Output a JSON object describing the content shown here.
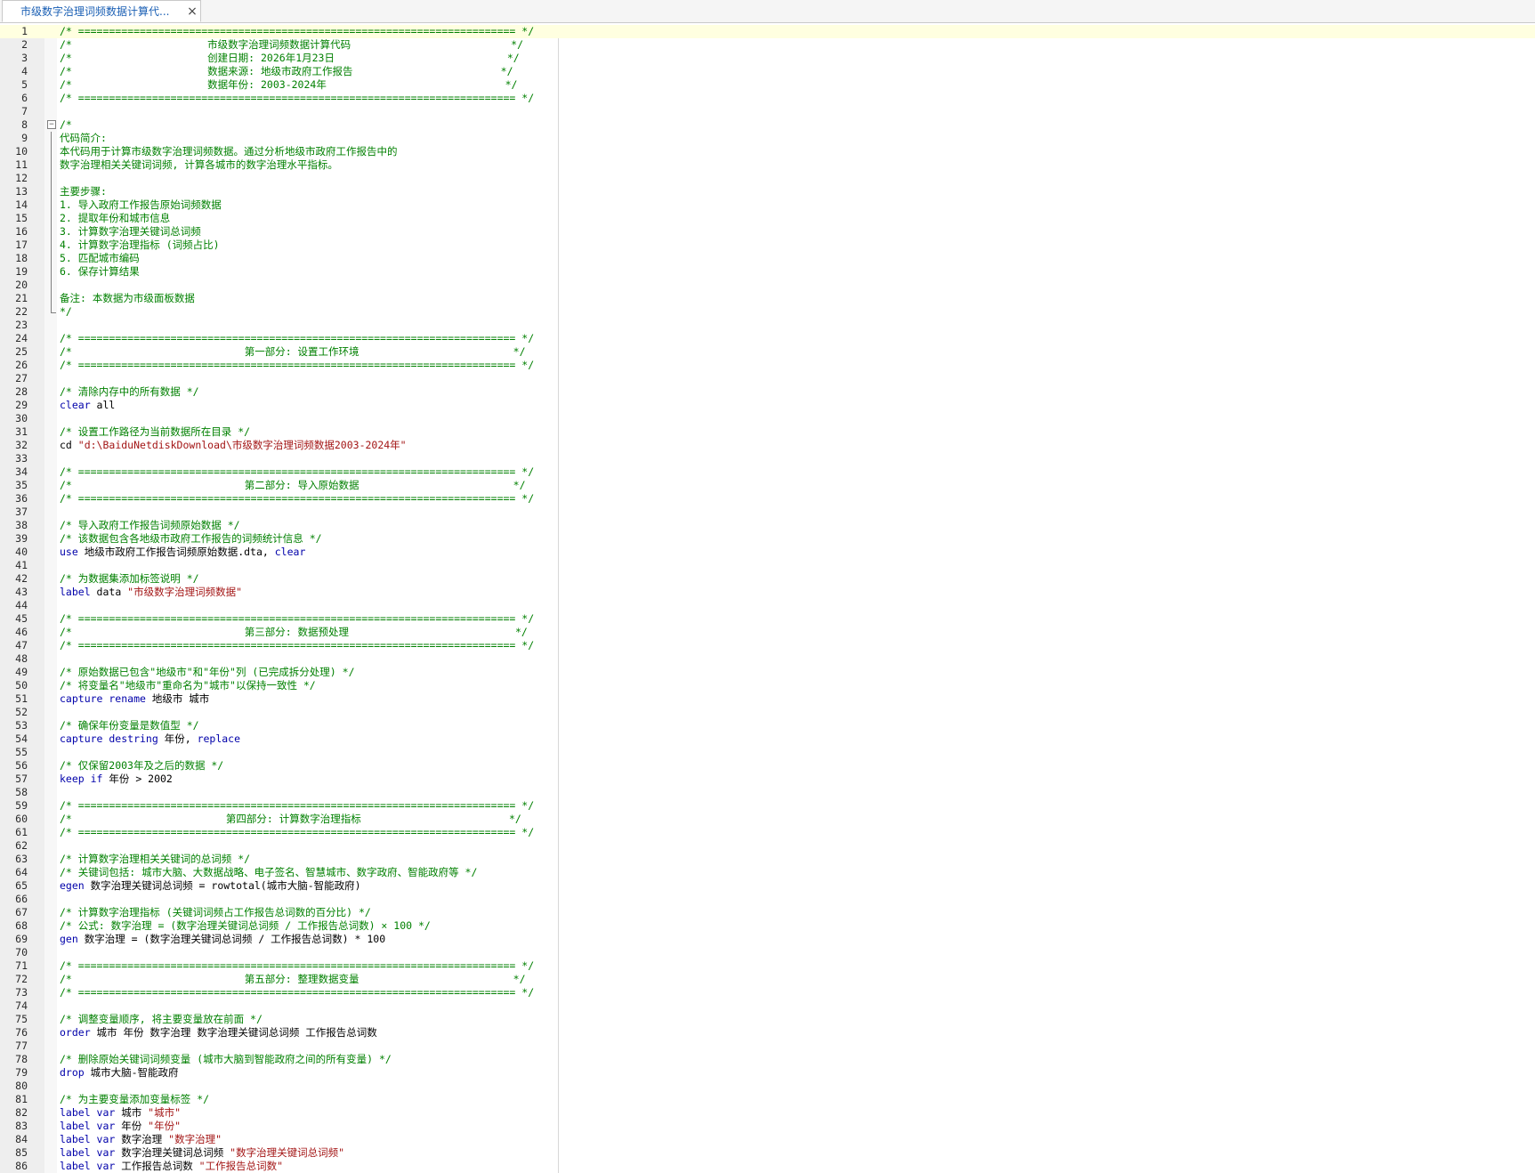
{
  "tab": {
    "title": "市级数字治理词频数据计算代...",
    "close": "×"
  },
  "lines": [
    {
      "n": "1",
      "parts": [
        {
          "t": "/* ======================================================================= */",
          "c": "comment"
        }
      ]
    },
    {
      "n": "2",
      "parts": [
        {
          "t": "/*                      市级数字治理词频数据计算代码                          */",
          "c": "comment"
        }
      ]
    },
    {
      "n": "3",
      "parts": [
        {
          "t": "/*                      创建日期: 2026年1月23日                            */",
          "c": "comment"
        }
      ]
    },
    {
      "n": "4",
      "parts": [
        {
          "t": "/*                      数据来源: 地级市政府工作报告                        */",
          "c": "comment"
        }
      ]
    },
    {
      "n": "5",
      "parts": [
        {
          "t": "/*                      数据年份: 2003-2024年                             */",
          "c": "comment"
        }
      ]
    },
    {
      "n": "6",
      "parts": [
        {
          "t": "/* ======================================================================= */",
          "c": "comment"
        }
      ]
    },
    {
      "n": "7",
      "parts": []
    },
    {
      "n": "8",
      "parts": [
        {
          "t": "/*",
          "c": "comment"
        }
      ]
    },
    {
      "n": "9",
      "parts": [
        {
          "t": "代码简介:",
          "c": "comment"
        }
      ]
    },
    {
      "n": "10",
      "parts": [
        {
          "t": "本代码用于计算市级数字治理词频数据。通过分析地级市政府工作报告中的",
          "c": "comment"
        }
      ]
    },
    {
      "n": "11",
      "parts": [
        {
          "t": "数字治理相关关键词词频, 计算各城市的数字治理水平指标。",
          "c": "comment"
        }
      ]
    },
    {
      "n": "12",
      "parts": []
    },
    {
      "n": "13",
      "parts": [
        {
          "t": "主要步骤:",
          "c": "comment"
        }
      ]
    },
    {
      "n": "14",
      "parts": [
        {
          "t": "1. 导入政府工作报告原始词频数据",
          "c": "comment"
        }
      ]
    },
    {
      "n": "15",
      "parts": [
        {
          "t": "2. 提取年份和城市信息",
          "c": "comment"
        }
      ]
    },
    {
      "n": "16",
      "parts": [
        {
          "t": "3. 计算数字治理关键词总词频",
          "c": "comment"
        }
      ]
    },
    {
      "n": "17",
      "parts": [
        {
          "t": "4. 计算数字治理指标 (词频占比)",
          "c": "comment"
        }
      ]
    },
    {
      "n": "18",
      "parts": [
        {
          "t": "5. 匹配城市编码",
          "c": "comment"
        }
      ]
    },
    {
      "n": "19",
      "parts": [
        {
          "t": "6. 保存计算结果",
          "c": "comment"
        }
      ]
    },
    {
      "n": "20",
      "parts": []
    },
    {
      "n": "21",
      "parts": [
        {
          "t": "备注: 本数据为市级面板数据",
          "c": "comment"
        }
      ]
    },
    {
      "n": "22",
      "parts": [
        {
          "t": "*/",
          "c": "comment"
        }
      ]
    },
    {
      "n": "23",
      "parts": []
    },
    {
      "n": "24",
      "parts": [
        {
          "t": "/* ======================================================================= */",
          "c": "comment"
        }
      ]
    },
    {
      "n": "25",
      "parts": [
        {
          "t": "/*                            第一部分: 设置工作环境                         */",
          "c": "comment"
        }
      ]
    },
    {
      "n": "26",
      "parts": [
        {
          "t": "/* ======================================================================= */",
          "c": "comment"
        }
      ]
    },
    {
      "n": "27",
      "parts": []
    },
    {
      "n": "28",
      "parts": [
        {
          "t": "/* 清除内存中的所有数据 */",
          "c": "comment"
        }
      ]
    },
    {
      "n": "29",
      "parts": [
        {
          "t": "clear",
          "c": "kw"
        },
        {
          "t": " all",
          "c": ""
        }
      ]
    },
    {
      "n": "30",
      "parts": []
    },
    {
      "n": "31",
      "parts": [
        {
          "t": "/* 设置工作路径为当前数据所在目录 */",
          "c": "comment"
        }
      ]
    },
    {
      "n": "32",
      "parts": [
        {
          "t": "cd ",
          "c": ""
        },
        {
          "t": "\"d:\\BaiduNetdiskDownload\\市级数字治理词频数据2003-2024年\"",
          "c": "str"
        }
      ]
    },
    {
      "n": "33",
      "parts": []
    },
    {
      "n": "34",
      "parts": [
        {
          "t": "/* ======================================================================= */",
          "c": "comment"
        }
      ]
    },
    {
      "n": "35",
      "parts": [
        {
          "t": "/*                            第二部分: 导入原始数据                         */",
          "c": "comment"
        }
      ]
    },
    {
      "n": "36",
      "parts": [
        {
          "t": "/* ======================================================================= */",
          "c": "comment"
        }
      ]
    },
    {
      "n": "37",
      "parts": []
    },
    {
      "n": "38",
      "parts": [
        {
          "t": "/* 导入政府工作报告词频原始数据 */",
          "c": "comment"
        }
      ]
    },
    {
      "n": "39",
      "parts": [
        {
          "t": "/* 该数据包含各地级市政府工作报告的词频统计信息 */",
          "c": "comment"
        }
      ]
    },
    {
      "n": "40",
      "parts": [
        {
          "t": "use",
          "c": "kw"
        },
        {
          "t": " 地级市政府工作报告词频原始数据.dta, ",
          "c": ""
        },
        {
          "t": "clear",
          "c": "kw"
        }
      ]
    },
    {
      "n": "41",
      "parts": []
    },
    {
      "n": "42",
      "parts": [
        {
          "t": "/* 为数据集添加标签说明 */",
          "c": "comment"
        }
      ]
    },
    {
      "n": "43",
      "parts": [
        {
          "t": "label",
          "c": "kw"
        },
        {
          "t": " data ",
          "c": ""
        },
        {
          "t": "\"市级数字治理词频数据\"",
          "c": "str"
        }
      ]
    },
    {
      "n": "44",
      "parts": []
    },
    {
      "n": "45",
      "parts": [
        {
          "t": "/* ======================================================================= */",
          "c": "comment"
        }
      ]
    },
    {
      "n": "46",
      "parts": [
        {
          "t": "/*                            第三部分: 数据预处理                           */",
          "c": "comment"
        }
      ]
    },
    {
      "n": "47",
      "parts": [
        {
          "t": "/* ======================================================================= */",
          "c": "comment"
        }
      ]
    },
    {
      "n": "48",
      "parts": []
    },
    {
      "n": "49",
      "parts": [
        {
          "t": "/* 原始数据已包含\"地级市\"和\"年份\"列 (已完成拆分处理) */",
          "c": "comment"
        }
      ]
    },
    {
      "n": "50",
      "parts": [
        {
          "t": "/* 将变量名\"地级市\"重命名为\"城市\"以保持一致性 */",
          "c": "comment"
        }
      ]
    },
    {
      "n": "51",
      "parts": [
        {
          "t": "capture rename",
          "c": "kw"
        },
        {
          "t": " 地级市 城市",
          "c": ""
        }
      ]
    },
    {
      "n": "52",
      "parts": []
    },
    {
      "n": "53",
      "parts": [
        {
          "t": "/* 确保年份变量是数值型 */",
          "c": "comment"
        }
      ]
    },
    {
      "n": "54",
      "parts": [
        {
          "t": "capture destring",
          "c": "kw"
        },
        {
          "t": " 年份, ",
          "c": ""
        },
        {
          "t": "replace",
          "c": "kw"
        }
      ]
    },
    {
      "n": "55",
      "parts": []
    },
    {
      "n": "56",
      "parts": [
        {
          "t": "/* 仅保留2003年及之后的数据 */",
          "c": "comment"
        }
      ]
    },
    {
      "n": "57",
      "parts": [
        {
          "t": "keep if",
          "c": "kw"
        },
        {
          "t": " 年份 > 2002",
          "c": ""
        }
      ]
    },
    {
      "n": "58",
      "parts": []
    },
    {
      "n": "59",
      "parts": [
        {
          "t": "/* ======================================================================= */",
          "c": "comment"
        }
      ]
    },
    {
      "n": "60",
      "parts": [
        {
          "t": "/*                         第四部分: 计算数字治理指标                        */",
          "c": "comment"
        }
      ]
    },
    {
      "n": "61",
      "parts": [
        {
          "t": "/* ======================================================================= */",
          "c": "comment"
        }
      ]
    },
    {
      "n": "62",
      "parts": []
    },
    {
      "n": "63",
      "parts": [
        {
          "t": "/* 计算数字治理相关关键词的总词频 */",
          "c": "comment"
        }
      ]
    },
    {
      "n": "64",
      "parts": [
        {
          "t": "/* 关键词包括: 城市大脑、大数据战略、电子签名、智慧城市、数字政府、智能政府等 */",
          "c": "comment"
        }
      ]
    },
    {
      "n": "65",
      "parts": [
        {
          "t": "egen",
          "c": "kw"
        },
        {
          "t": " 数字治理关键词总词频 = rowtotal(城市大脑-智能政府)",
          "c": ""
        }
      ]
    },
    {
      "n": "66",
      "parts": []
    },
    {
      "n": "67",
      "parts": [
        {
          "t": "/* 计算数字治理指标 (关键词词频占工作报告总词数的百分比) */",
          "c": "comment"
        }
      ]
    },
    {
      "n": "68",
      "parts": [
        {
          "t": "/* 公式: 数字治理 = (数字治理关键词总词频 / 工作报告总词数) × 100 */",
          "c": "comment"
        }
      ]
    },
    {
      "n": "69",
      "parts": [
        {
          "t": "gen",
          "c": "kw"
        },
        {
          "t": " 数字治理 = (数字治理关键词总词频 / 工作报告总词数) * 100",
          "c": ""
        }
      ]
    },
    {
      "n": "70",
      "parts": []
    },
    {
      "n": "71",
      "parts": [
        {
          "t": "/* ======================================================================= */",
          "c": "comment"
        }
      ]
    },
    {
      "n": "72",
      "parts": [
        {
          "t": "/*                            第五部分: 整理数据变量                         */",
          "c": "comment"
        }
      ]
    },
    {
      "n": "73",
      "parts": [
        {
          "t": "/* ======================================================================= */",
          "c": "comment"
        }
      ]
    },
    {
      "n": "74",
      "parts": []
    },
    {
      "n": "75",
      "parts": [
        {
          "t": "/* 调整变量顺序, 将主要变量放在前面 */",
          "c": "comment"
        }
      ]
    },
    {
      "n": "76",
      "parts": [
        {
          "t": "order",
          "c": "kw"
        },
        {
          "t": " 城市 年份 数字治理 数字治理关键词总词频 工作报告总词数",
          "c": ""
        }
      ]
    },
    {
      "n": "77",
      "parts": []
    },
    {
      "n": "78",
      "parts": [
        {
          "t": "/* 删除原始关键词词频变量 (城市大脑到智能政府之间的所有变量) */",
          "c": "comment"
        }
      ]
    },
    {
      "n": "79",
      "parts": [
        {
          "t": "drop",
          "c": "kw"
        },
        {
          "t": " 城市大脑-智能政府",
          "c": ""
        }
      ]
    },
    {
      "n": "80",
      "parts": []
    },
    {
      "n": "81",
      "parts": [
        {
          "t": "/* 为主要变量添加变量标签 */",
          "c": "comment"
        }
      ]
    },
    {
      "n": "82",
      "parts": [
        {
          "t": "label var",
          "c": "kw"
        },
        {
          "t": " 城市 ",
          "c": ""
        },
        {
          "t": "\"城市\"",
          "c": "str"
        }
      ]
    },
    {
      "n": "83",
      "parts": [
        {
          "t": "label var",
          "c": "kw"
        },
        {
          "t": " 年份 ",
          "c": ""
        },
        {
          "t": "\"年份\"",
          "c": "str"
        }
      ]
    },
    {
      "n": "84",
      "parts": [
        {
          "t": "label var",
          "c": "kw"
        },
        {
          "t": " 数字治理 ",
          "c": ""
        },
        {
          "t": "\"数字治理\"",
          "c": "str"
        }
      ]
    },
    {
      "n": "85",
      "parts": [
        {
          "t": "label var",
          "c": "kw"
        },
        {
          "t": " 数字治理关键词总词频 ",
          "c": ""
        },
        {
          "t": "\"数字治理关键词总词频\"",
          "c": "str"
        }
      ]
    },
    {
      "n": "86",
      "parts": [
        {
          "t": "label var",
          "c": "kw"
        },
        {
          "t": " 工作报告总词数 ",
          "c": ""
        },
        {
          "t": "\"工作报告总词数\"",
          "c": "str"
        }
      ]
    }
  ]
}
